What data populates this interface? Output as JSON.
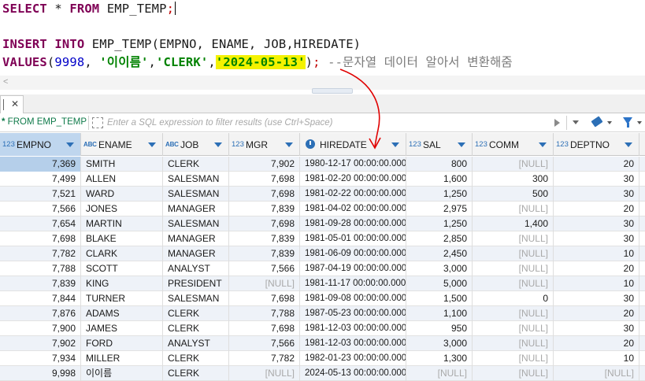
{
  "editor": {
    "line1": {
      "kw_select": "SELECT",
      "star": " * ",
      "kw_from": "FROM",
      "table": " EMP_TEMP",
      "semi": ";"
    },
    "line2": {
      "kw_insert": "INSERT",
      "kw_into": " INTO",
      "rest": " EMP_TEMP(EMPNO, ENAME, JOB,HIREDATE)"
    },
    "line3": {
      "kw_values": "VALUES",
      "open": "(",
      "num": "9998",
      "sep1": ", ",
      "str1": "'이이름'",
      "sep2": ",",
      "str2": "'CLERK'",
      "sep3": ",",
      "str3a": "'",
      "str3_highlight": "2024-05-13",
      "str3b": "'",
      "close": ")",
      "semi": ";",
      "comment": " --문자열 데이터 알아서 변환해줌"
    },
    "hscroll_left": "<"
  },
  "result_tab": {
    "close": "✕"
  },
  "filter": {
    "label_prefix": "*",
    "label": " FROM EMP_TEMP",
    "placeholder": "Enter a SQL expression to filter results (use Ctrl+Space)"
  },
  "columns": [
    {
      "type": "123",
      "name": "EMPNO"
    },
    {
      "type": "ABC",
      "name": "ENAME"
    },
    {
      "type": "ABC",
      "name": "JOB"
    },
    {
      "type": "123",
      "name": "MGR"
    },
    {
      "type": "clock",
      "name": "HIREDATE"
    },
    {
      "type": "123",
      "name": "SAL"
    },
    {
      "type": "123",
      "name": "COMM"
    },
    {
      "type": "123",
      "name": "DEPTNO"
    }
  ],
  "rows": [
    [
      "7,369",
      "SMITH",
      "CLERK",
      "7,902",
      "1980-12-17 00:00:00.000",
      "800",
      "[NULL]",
      "20"
    ],
    [
      "7,499",
      "ALLEN",
      "SALESMAN",
      "7,698",
      "1981-02-20 00:00:00.000",
      "1,600",
      "300",
      "30"
    ],
    [
      "7,521",
      "WARD",
      "SALESMAN",
      "7,698",
      "1981-02-22 00:00:00.000",
      "1,250",
      "500",
      "30"
    ],
    [
      "7,566",
      "JONES",
      "MANAGER",
      "7,839",
      "1981-04-02 00:00:00.000",
      "2,975",
      "[NULL]",
      "20"
    ],
    [
      "7,654",
      "MARTIN",
      "SALESMAN",
      "7,698",
      "1981-09-28 00:00:00.000",
      "1,250",
      "1,400",
      "30"
    ],
    [
      "7,698",
      "BLAKE",
      "MANAGER",
      "7,839",
      "1981-05-01 00:00:00.000",
      "2,850",
      "[NULL]",
      "30"
    ],
    [
      "7,782",
      "CLARK",
      "MANAGER",
      "7,839",
      "1981-06-09 00:00:00.000",
      "2,450",
      "[NULL]",
      "10"
    ],
    [
      "7,788",
      "SCOTT",
      "ANALYST",
      "7,566",
      "1987-04-19 00:00:00.000",
      "3,000",
      "[NULL]",
      "20"
    ],
    [
      "7,839",
      "KING",
      "PRESIDENT",
      "[NULL]",
      "1981-11-17 00:00:00.000",
      "5,000",
      "[NULL]",
      "10"
    ],
    [
      "7,844",
      "TURNER",
      "SALESMAN",
      "7,698",
      "1981-09-08 00:00:00.000",
      "1,500",
      "0",
      "30"
    ],
    [
      "7,876",
      "ADAMS",
      "CLERK",
      "7,788",
      "1987-05-23 00:00:00.000",
      "1,100",
      "[NULL]",
      "20"
    ],
    [
      "7,900",
      "JAMES",
      "CLERK",
      "7,698",
      "1981-12-03 00:00:00.000",
      "950",
      "[NULL]",
      "30"
    ],
    [
      "7,902",
      "FORD",
      "ANALYST",
      "7,566",
      "1981-12-03 00:00:00.000",
      "3,000",
      "[NULL]",
      "20"
    ],
    [
      "7,934",
      "MILLER",
      "CLERK",
      "7,782",
      "1982-01-23 00:00:00.000",
      "1,300",
      "[NULL]",
      "10"
    ],
    [
      "9,998",
      "이이름",
      "CLERK",
      "[NULL]",
      "2024-05-13 00:00:00.000",
      "[NULL]",
      "[NULL]",
      "[NULL]"
    ]
  ],
  "colors": {
    "keyword": "#7f0055",
    "number": "#0000c8",
    "string": "#008200",
    "highlight": "#f4f200",
    "annotation_arrow": "#e00000",
    "selected_header": "#bfd6ee",
    "row_alt": "#eef2f8"
  }
}
